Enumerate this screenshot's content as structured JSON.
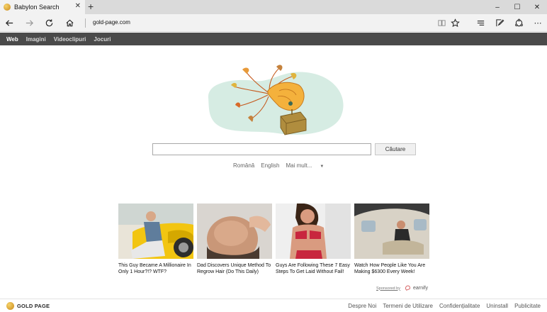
{
  "browser": {
    "tab_title": "Babylon Search",
    "tab_close": "✕",
    "new_tab": "+",
    "url": "gold-page.com",
    "window_controls": [
      "–",
      "☐",
      "✕"
    ],
    "toolbar_menu": "⋯"
  },
  "site_nav": {
    "items": [
      {
        "label": "Web",
        "active": true
      },
      {
        "label": "Imagini",
        "active": false
      },
      {
        "label": "Videoclipuri",
        "active": false
      },
      {
        "label": "Jocuri",
        "active": false
      }
    ]
  },
  "search": {
    "query": "",
    "button_label": "Căutare",
    "languages": [
      "Română",
      "English"
    ],
    "more_label": "Mai mult...",
    "more_arrow": "▼"
  },
  "sponsored": {
    "label": "Sponsored by",
    "brand": "earnify",
    "cards": [
      {
        "caption": "This Guy Became A Millionaire In Only 1 Hour?!? WTF?"
      },
      {
        "caption": "Dad Discovers Unique Method To Regrow Hair (Do This Daily)"
      },
      {
        "caption": "Guys Are Following These 7 Easy Steps To Get Laid Without Fail!"
      },
      {
        "caption": "Watch How People Like You Are Making $6300 Every Week!"
      }
    ]
  },
  "footer": {
    "logo_text": "GOLD PAGE",
    "links": [
      "Despre Noi",
      "Termeni de Utilizare",
      "Confidențialitate",
      "Uninstall",
      "Publicitate"
    ]
  }
}
